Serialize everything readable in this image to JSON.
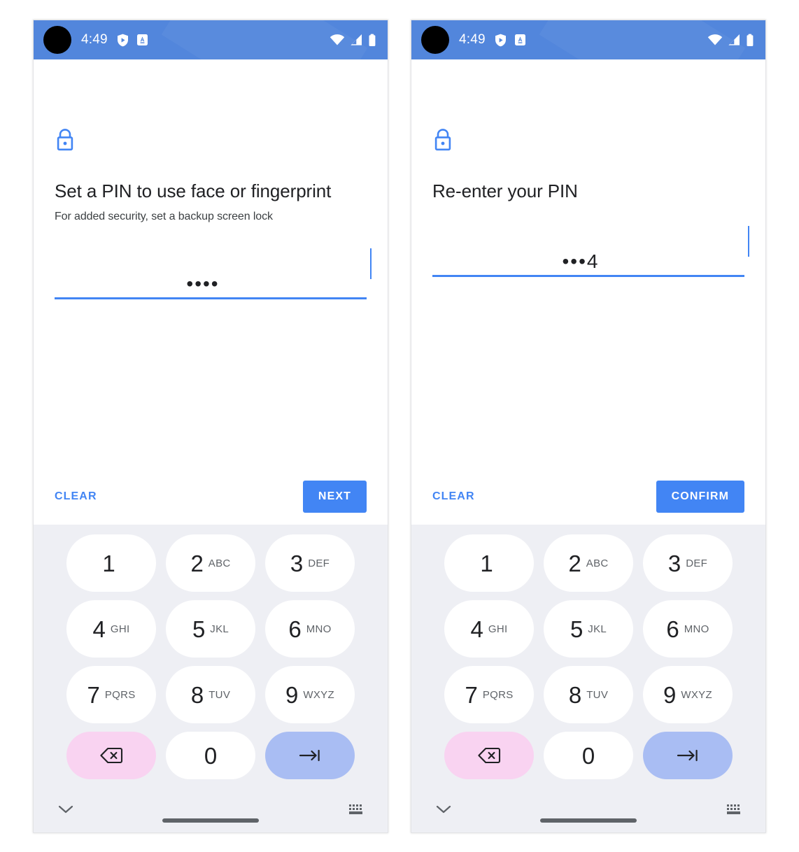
{
  "colors": {
    "status_bar": "#5286DC",
    "accent_blue": "#4285F4",
    "keypad_bg": "#EEEFF4",
    "key_white": "#FFFFFF",
    "backspace_pink": "#F9D3F1",
    "enter_blue": "#A9BDF3",
    "title_text": "#202124",
    "letters_text": "#5F6368"
  },
  "status_bar": {
    "time": "4:49",
    "left_icons": [
      "play-protect-shield-icon",
      "app-notification-icon"
    ],
    "right_icons": [
      "wifi-icon",
      "cellular-signal-icon",
      "battery-icon"
    ],
    "camera_cutout": "front-camera-cutout"
  },
  "keypad": {
    "rows": [
      [
        {
          "digit": "1",
          "letters": "",
          "name": "key-1"
        },
        {
          "digit": "2",
          "letters": "ABC",
          "name": "key-2"
        },
        {
          "digit": "3",
          "letters": "DEF",
          "name": "key-3"
        }
      ],
      [
        {
          "digit": "4",
          "letters": "GHI",
          "name": "key-4"
        },
        {
          "digit": "5",
          "letters": "JKL",
          "name": "key-5"
        },
        {
          "digit": "6",
          "letters": "MNO",
          "name": "key-6"
        }
      ],
      [
        {
          "digit": "7",
          "letters": "PQRS",
          "name": "key-7"
        },
        {
          "digit": "8",
          "letters": "TUV",
          "name": "key-8"
        },
        {
          "digit": "9",
          "letters": "WXYZ",
          "name": "key-9"
        }
      ]
    ],
    "bottom_row": {
      "backspace_icon": "backspace-icon",
      "zero": "0",
      "enter_icon": "enter-tab-arrow-icon"
    }
  },
  "nav_bar": {
    "left_icon": "hide-keyboard-chevron-down-icon",
    "right_icon": "switch-keyboard-icon",
    "home_indicator": "gesture-home-bar"
  },
  "panels": [
    {
      "id": "set-pin-screen",
      "lock_icon": "lock-icon",
      "title": "Set a PIN to use face or fingerprint",
      "subtitle": "For added security, set a backup screen lock",
      "pin_value": "••••",
      "clear_label": "CLEAR",
      "primary_label": "NEXT"
    },
    {
      "id": "confirm-pin-screen",
      "lock_icon": "lock-icon",
      "title": "Re-enter your PIN",
      "subtitle": "",
      "pin_value": "•••4",
      "clear_label": "CLEAR",
      "primary_label": "CONFIRM"
    }
  ]
}
